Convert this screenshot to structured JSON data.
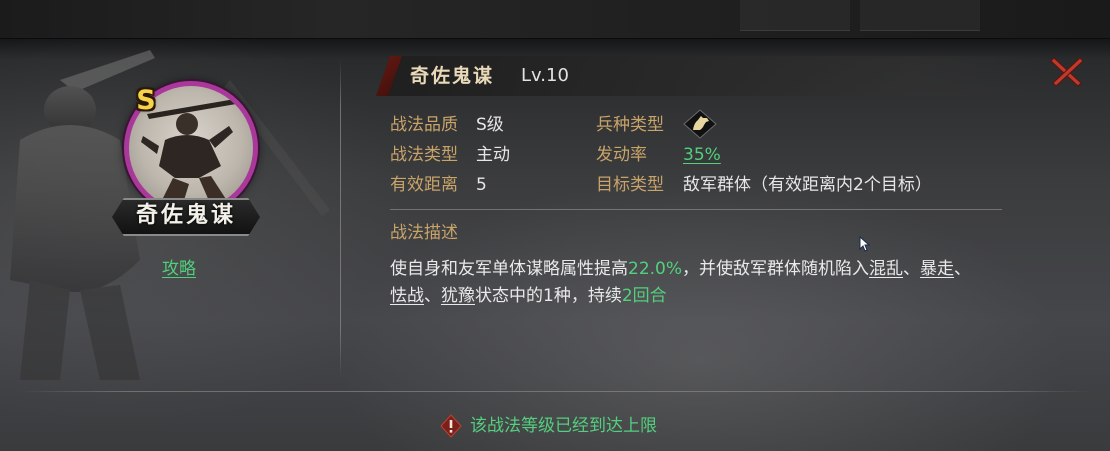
{
  "skill": {
    "grade_badge": "S",
    "banner_name": "奇佐鬼谋",
    "strategy_link": "攻略",
    "title_name": "奇佐鬼谋",
    "level": "Lv.10"
  },
  "attributes": {
    "quality_label": "战法品质",
    "quality_value": "S级",
    "type_label": "战法类型",
    "type_value": "主动",
    "range_label": "有效距离",
    "range_value": "5",
    "troop_label": "兵种类型",
    "troop_icon": "cavalry-horse-icon",
    "rate_label": "发动率",
    "rate_value": "35%",
    "target_label": "目标类型",
    "target_value": "敌军群体（有效距离内2个目标）"
  },
  "description": {
    "heading": "战法描述",
    "part1": "使自身和友军单体谋略属性提高",
    "value1": "22.0%",
    "part2": "，并使敌军群体随机陷入",
    "status1": "混乱",
    "sep1": "、",
    "status2": "暴走",
    "sep2": "、",
    "status3": "怯战",
    "sep3": "、",
    "status4": "犹豫",
    "part3": "状态中的1种，持续",
    "duration": "2回合"
  },
  "footer": {
    "notice": "该战法等级已经到达上限"
  },
  "colors": {
    "label_gold": "#c8a36a",
    "highlight_green": "#53d07e",
    "portrait_ring": "#a9389a",
    "close_red": "#c0392b"
  }
}
